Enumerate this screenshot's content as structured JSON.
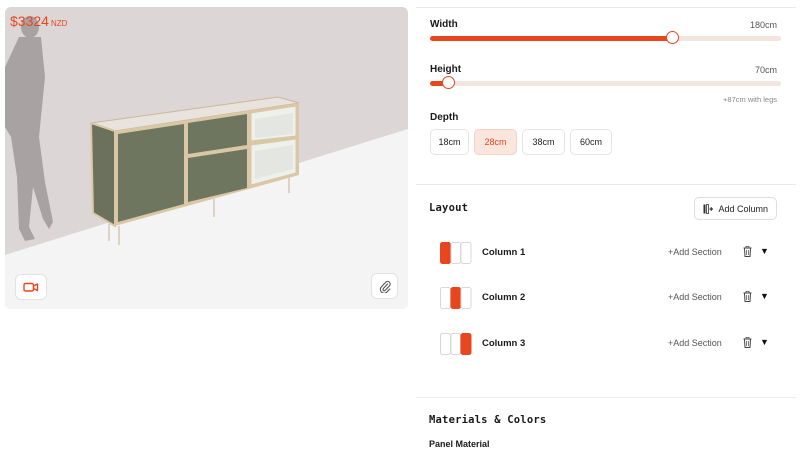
{
  "preview": {
    "price": "$3324",
    "currency": "NZD",
    "camera_icon": "video-camera-icon",
    "clip_icon": "paperclip-icon"
  },
  "dimensions": {
    "width": {
      "label": "Width",
      "value": "180cm",
      "fraction": 0.69
    },
    "height": {
      "label": "Height",
      "value": "70cm",
      "fraction": 0.05
    },
    "legs_note": "+87cm with legs"
  },
  "depth": {
    "label": "Depth",
    "options": [
      "18cm",
      "28cm",
      "38cm",
      "60cm"
    ],
    "selected": "28cm"
  },
  "layout": {
    "title": "Layout",
    "add_column_label": "Add Column",
    "columns": [
      {
        "name": "Column 1",
        "add_section": "+Add Section",
        "highlight": 1
      },
      {
        "name": "Column 2",
        "add_section": "+Add Section",
        "highlight": 2
      },
      {
        "name": "Column 3",
        "add_section": "+Add Section",
        "highlight": 3
      }
    ]
  },
  "materials": {
    "title": "Materials & Colors",
    "panel_material_label": "Panel Material"
  },
  "colors": {
    "accent": "#e8461f",
    "accent_light": "#fbe6dd",
    "cabinet_green": "#6f7660"
  }
}
